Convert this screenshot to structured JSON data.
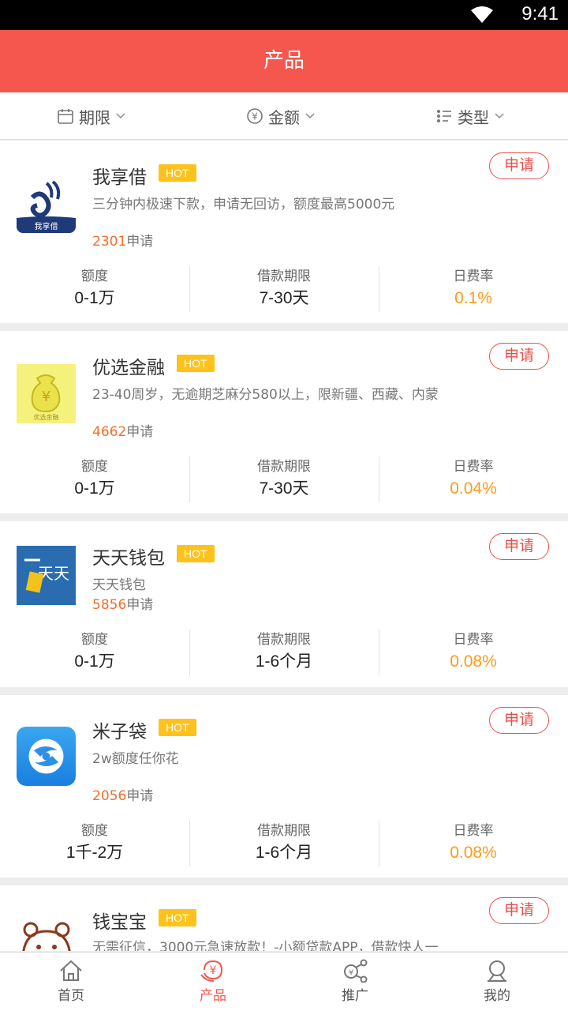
{
  "status": {
    "time": "9:41"
  },
  "header": {
    "title": "产品"
  },
  "filters": [
    {
      "label": "期限",
      "icon": "calendar-icon"
    },
    {
      "label": "金额",
      "icon": "yuan-icon"
    },
    {
      "label": "类型",
      "icon": "list-icon"
    }
  ],
  "common": {
    "hot": "HOT",
    "apply": "申请",
    "applied_suffix": "申请",
    "amount_label": "额度",
    "term_label": "借款期限",
    "rate_label": "日费率"
  },
  "products": [
    {
      "name": "我享借",
      "desc": "三分钟内极速下款，申请无回访，额度最高5000元",
      "count": "2301",
      "amount": "0-1万",
      "term": "7-30天",
      "rate": "0.1%",
      "logo_text": "我享借"
    },
    {
      "name": "优选金融",
      "desc": "23-40周岁，无逾期芝麻分580以上，限新疆、西藏、内蒙",
      "count": "4662",
      "amount": "0-1万",
      "term": "7-30天",
      "rate": "0.04%",
      "logo_text": "优选金融"
    },
    {
      "name": "天天钱包",
      "desc": "天天钱包",
      "count": "5856",
      "amount": "0-1万",
      "term": "1-6个月",
      "rate": "0.08%",
      "logo_text": "天天"
    },
    {
      "name": "米子袋",
      "desc": "2w额度任你花",
      "count": "2056",
      "amount": "1千-2万",
      "term": "1-6个月",
      "rate": "0.08%"
    },
    {
      "name": "钱宝宝",
      "desc": "无需征信，3000元急速放款！-小额贷款APP，借款快人一"
    }
  ],
  "tabs": [
    {
      "label": "首页",
      "icon": "home-icon"
    },
    {
      "label": "产品",
      "icon": "product-icon",
      "active": true
    },
    {
      "label": "推广",
      "icon": "share-icon"
    },
    {
      "label": "我的",
      "icon": "profile-icon"
    }
  ],
  "colors": {
    "brand": "#f5564e",
    "hot": "#ffc21a",
    "rate": "#ff9a17",
    "count": "#f26f2b"
  }
}
